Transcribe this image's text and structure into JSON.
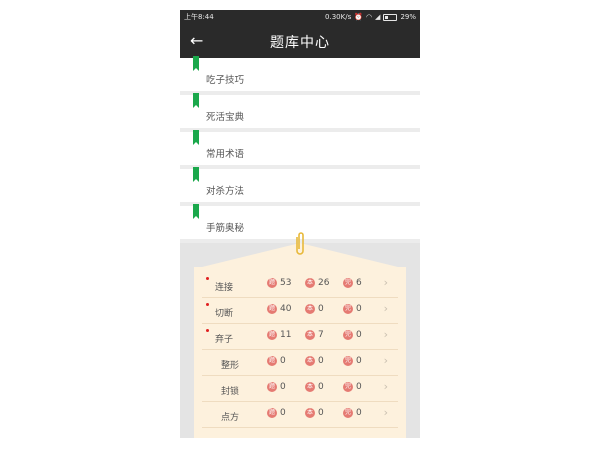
{
  "status": {
    "time": "上午8:44",
    "speed": "0.30K/s",
    "battery": "29%",
    "alarm_icon": "alarm-icon",
    "wifi_icon": "wifi-icon",
    "signal_icon": "signal-icon"
  },
  "header": {
    "title": "题库中心",
    "back_icon": "back-arrow-icon"
  },
  "categories": [
    {
      "label": "吃子技巧"
    },
    {
      "label": "死活宝典"
    },
    {
      "label": "常用术语"
    },
    {
      "label": "对杀方法"
    },
    {
      "label": "手筋奥秘"
    }
  ],
  "colors": {
    "accent_green": "#1aa84b",
    "badge_red": "#e57a72",
    "card_bg": "#fdf1dd",
    "dot_red": "#e02020"
  },
  "rows": [
    {
      "name": "连接",
      "new": true,
      "badges": [
        "题",
        "本",
        "完"
      ],
      "counts": [
        "53",
        "26",
        "6"
      ]
    },
    {
      "name": "切断",
      "new": true,
      "badges": [
        "题",
        "本",
        "完"
      ],
      "counts": [
        "40",
        "0",
        "0"
      ]
    },
    {
      "name": "弃子",
      "new": true,
      "badges": [
        "题",
        "本",
        "完"
      ],
      "counts": [
        "11",
        "7",
        "0"
      ]
    },
    {
      "name": "整形",
      "new": false,
      "badges": [
        "题",
        "本",
        "完"
      ],
      "counts": [
        "0",
        "0",
        "0"
      ]
    },
    {
      "name": "封锁",
      "new": false,
      "badges": [
        "题",
        "本",
        "完"
      ],
      "counts": [
        "0",
        "0",
        "0"
      ]
    },
    {
      "name": "点方",
      "new": false,
      "badges": [
        "题",
        "本",
        "完"
      ],
      "counts": [
        "0",
        "0",
        "0"
      ]
    }
  ]
}
